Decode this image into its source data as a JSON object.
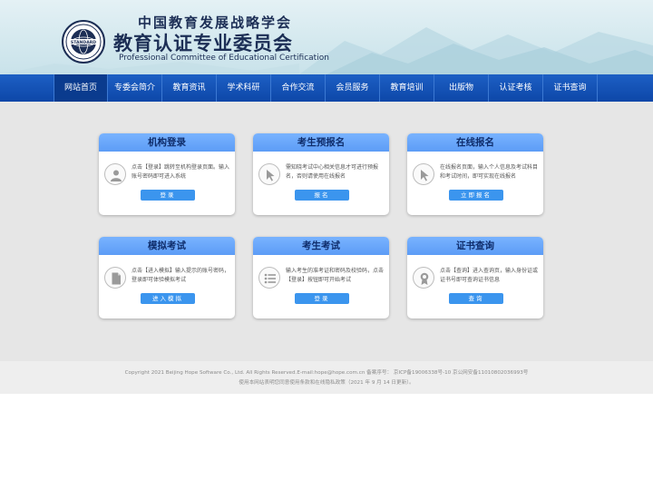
{
  "header": {
    "title_small": "中国教育发展战略学会",
    "title_big": "教育认证专业委员会",
    "title_en": "Professional Committee of Educational Certification",
    "logo_text": "STANDARD"
  },
  "nav": {
    "items": [
      {
        "label": "网站首页"
      },
      {
        "label": "专委会简介"
      },
      {
        "label": "教育资讯"
      },
      {
        "label": "学术科研"
      },
      {
        "label": "合作交流"
      },
      {
        "label": "会员服务"
      },
      {
        "label": "教育培训"
      },
      {
        "label": "出版物"
      },
      {
        "label": "认证考核"
      },
      {
        "label": "证书查询"
      }
    ],
    "active_index": 0
  },
  "cards": [
    {
      "title": "机构登录",
      "text": "点击【登录】跳转至机构登录页面。输入账号密码即可进入系统",
      "button": "登录",
      "icon": "user-icon"
    },
    {
      "title": "考生预报名",
      "text": "需知晓考试中心相关信息才可进行预报名，否则请使用在线报名",
      "button": "报名",
      "icon": "cursor-icon"
    },
    {
      "title": "在线报名",
      "text": "在线报名页面，输入个人信息及考试科目和考试时间，即可实现在线报名",
      "button": "立即报名",
      "icon": "cursor-icon"
    },
    {
      "title": "模拟考试",
      "text": "点击【进入模拟】输入提示的账号密码，登录即可体验模拟考试",
      "button": "进入模拟",
      "icon": "document-icon"
    },
    {
      "title": "考生考试",
      "text": "输入考生的准考证和密码及校验码，点击【登录】按钮即可开始考试",
      "button": "登录",
      "icon": "list-icon"
    },
    {
      "title": "证书查询",
      "text": "点击【查询】进入查询页，输入身份证或证书号即可查询证书信息",
      "button": "查询",
      "icon": "award-icon"
    }
  ],
  "footer": {
    "line1": "Copyright 2021 Beijing Hope Software Co., Ltd. All Rights Reserved.E-mail:hope@hope.com.cn 备案序号： 京ICP备19006338号-10 京公网安备11010802036993号",
    "line2": "使用本网站表明您同意使用条款和在线隐私政策（2021 年 9 月 14 日更新）。"
  },
  "colors": {
    "nav": "#0d47a8",
    "card_head": "#5c9cf6",
    "button": "#3b95ee",
    "main_bg": "#e6e6e6"
  }
}
